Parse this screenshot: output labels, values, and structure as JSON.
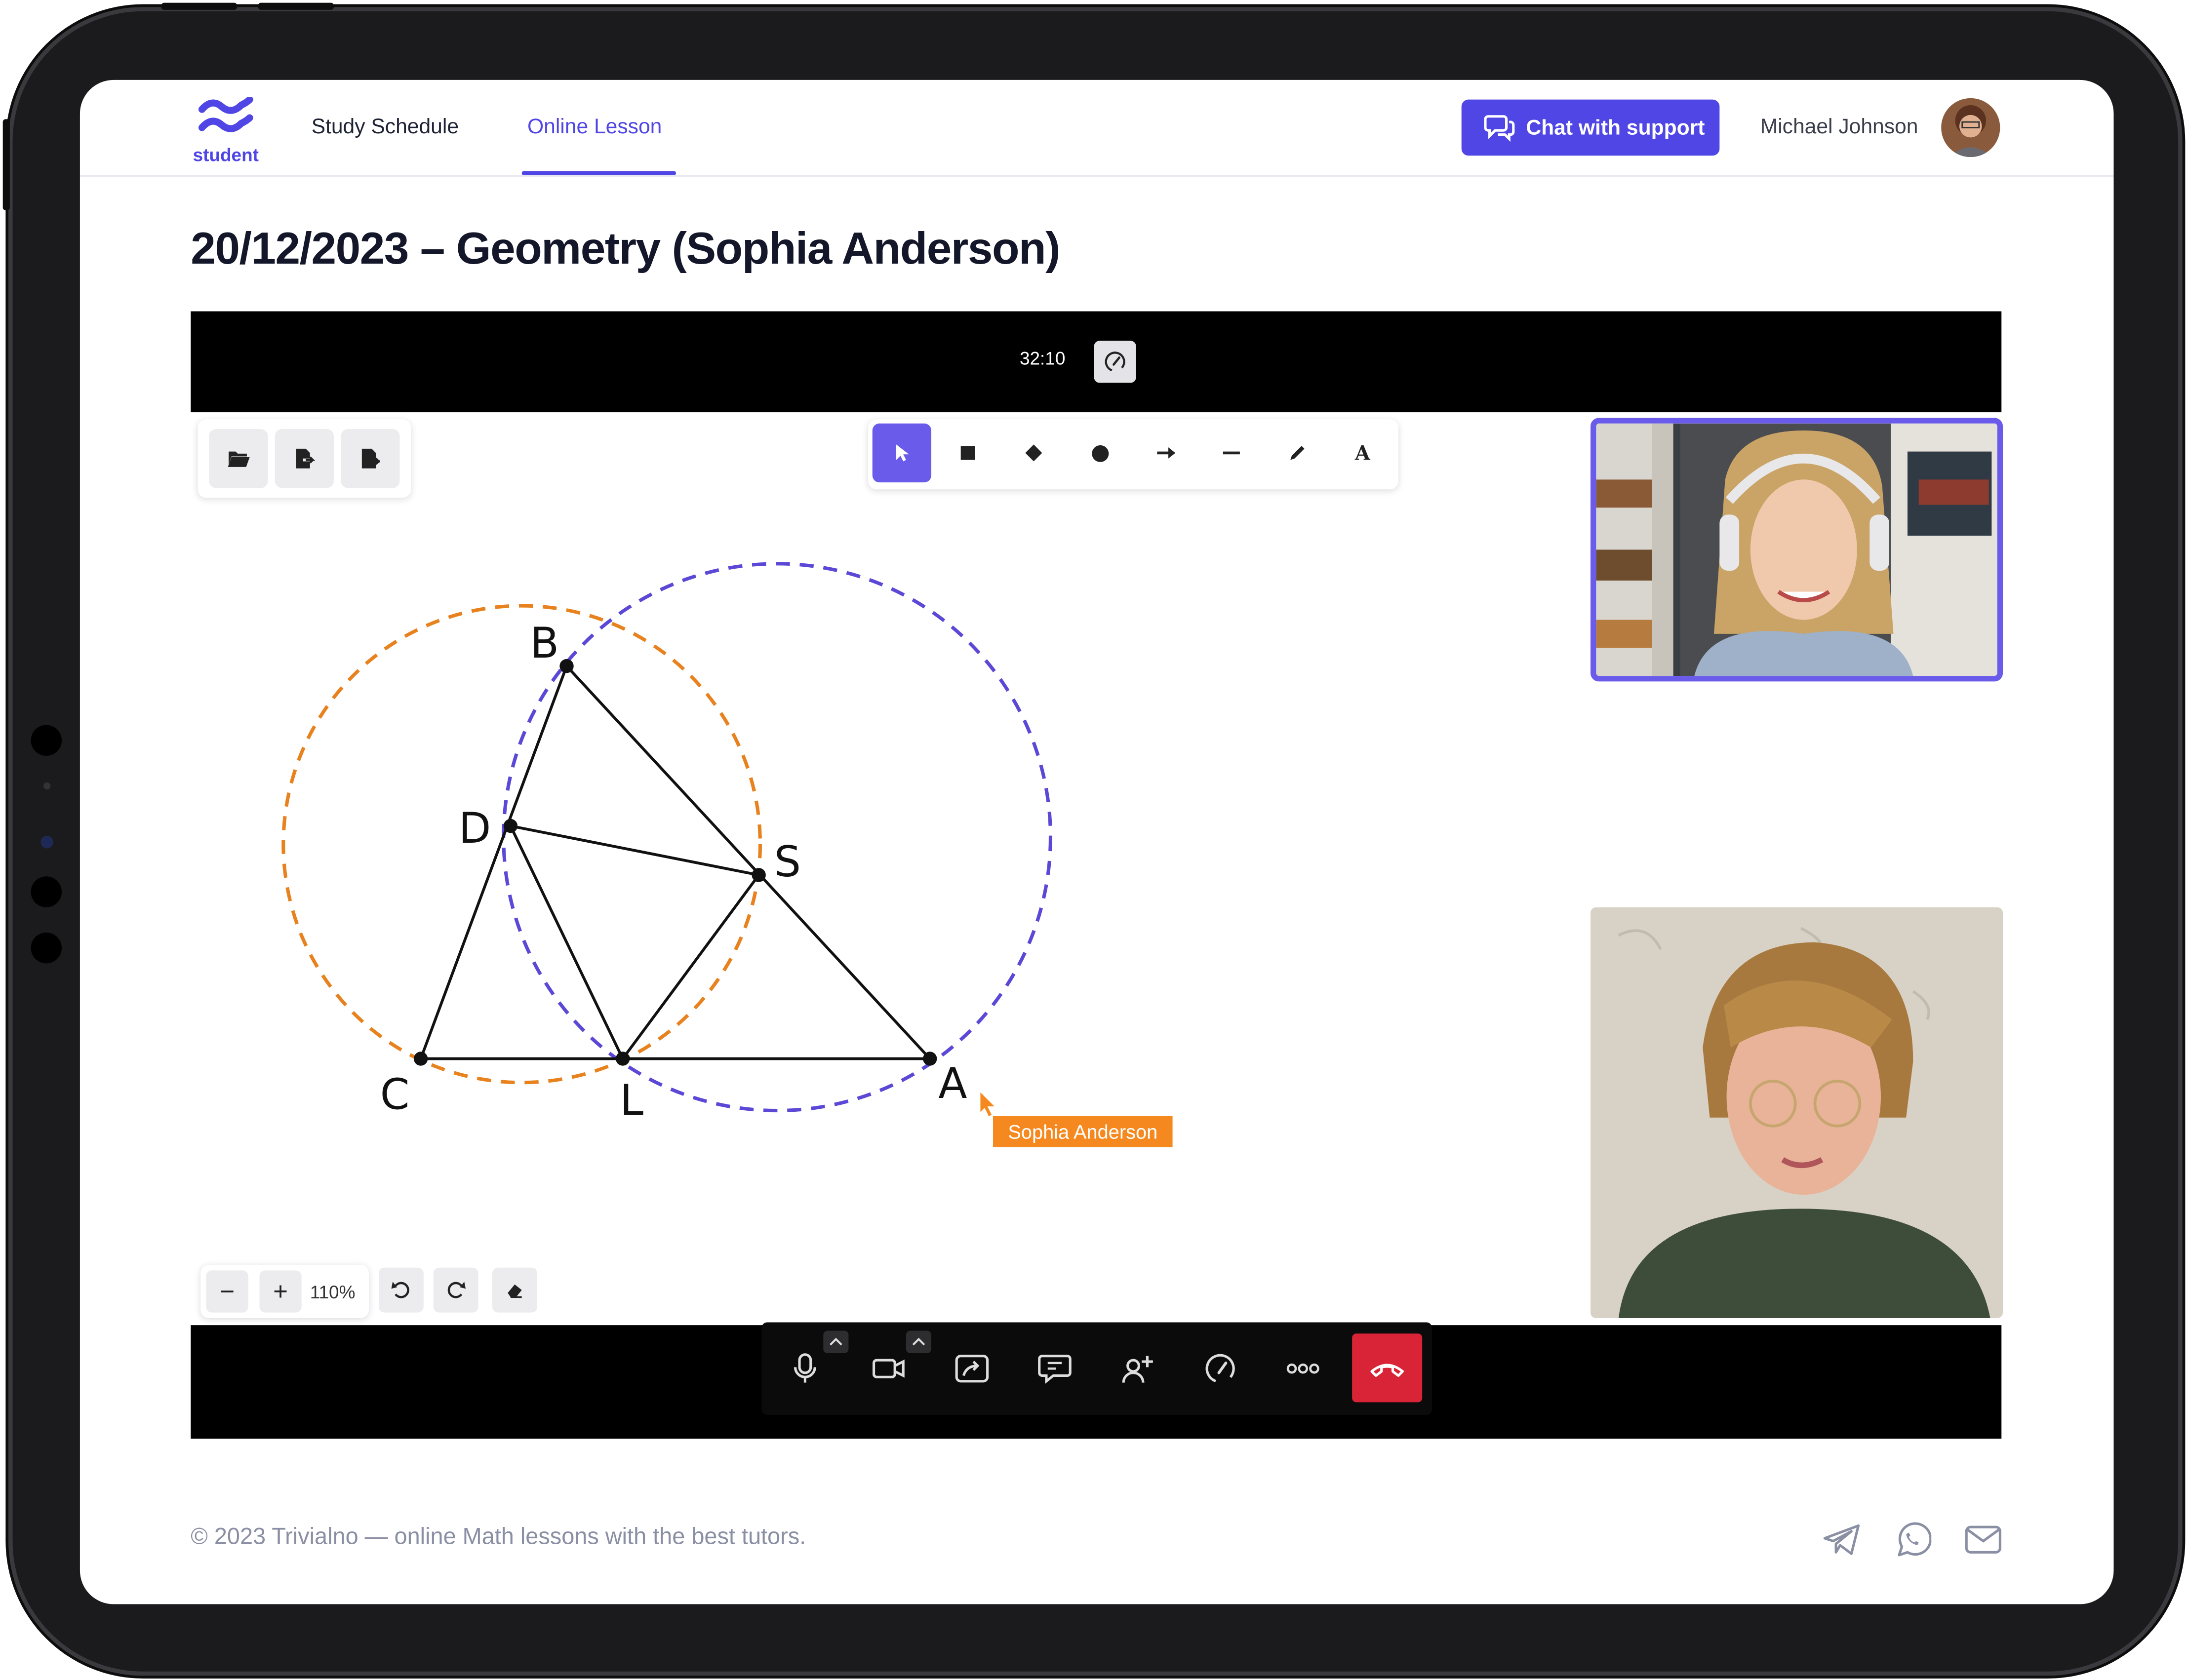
{
  "header": {
    "logo_label": "student",
    "nav": [
      {
        "label": "Study Schedule",
        "active": false
      },
      {
        "label": "Online Lesson",
        "active": true
      }
    ],
    "chat_button": "Chat with support",
    "user_name": "Michael Johnson"
  },
  "page_title": "20/12/2023 – Geometry (Sophia Anderson)",
  "lesson": {
    "timer": "32:10",
    "file_tools": [
      "folder-open-icon",
      "file-export-icon",
      "file-import-icon"
    ],
    "draw_tools": [
      "pointer-icon",
      "rectangle-icon",
      "diamond-icon",
      "circle-icon",
      "arrow-icon",
      "line-icon",
      "pencil-icon",
      "text-icon"
    ],
    "active_tool": "pointer-icon",
    "whiteboard": {
      "points": [
        "B",
        "D",
        "S",
        "C",
        "L",
        "A"
      ],
      "circle_colors": {
        "orange": "#e8821e",
        "purple": "#5b48d6"
      }
    },
    "remote_cursor_label": "Sophia Anderson",
    "zoom": {
      "minus": "−",
      "plus": "+",
      "level": "110%"
    },
    "call_controls": [
      "microphone-icon",
      "camera-icon",
      "share-screen-icon",
      "chat-icon",
      "add-participant-icon",
      "speed-icon",
      "more-icon",
      "hang-up-icon"
    ]
  },
  "footer": {
    "copyright": "© 2023 Trivialno — online Math lessons with the best tutors.",
    "icons": [
      "telegram-icon",
      "whatsapp-icon",
      "mail-icon"
    ]
  },
  "colors": {
    "accent": "#5046e5",
    "tool_active": "#6a5bea",
    "hangup": "#d92336",
    "cursor_label": "#f5891f"
  }
}
